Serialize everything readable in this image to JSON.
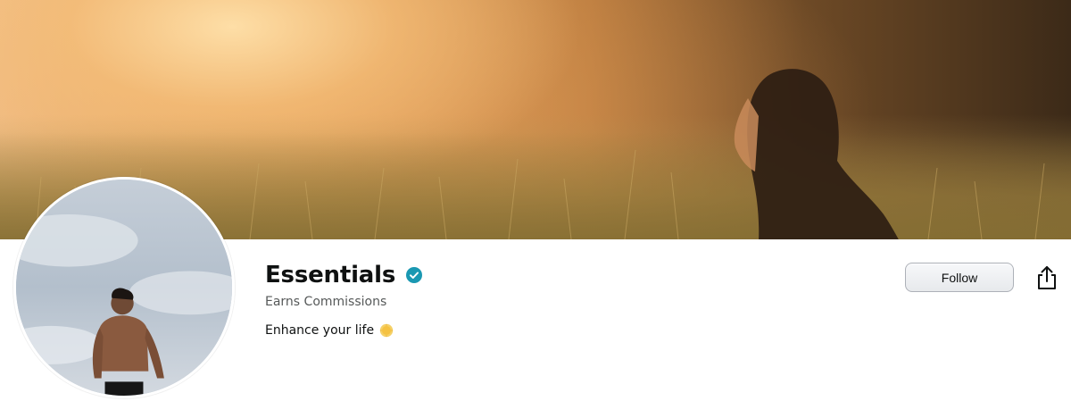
{
  "banner": {
    "image": "cover-photo-woman-in-golden-field"
  },
  "profile": {
    "avatar": "profile-photo-man-against-sky",
    "name": "Essentials",
    "verified_icon": "verified-check-icon",
    "subtitle": "Earns Commissions",
    "bio_text": "Enhance your life",
    "bio_emoji": "sun-emoji-icon"
  },
  "actions": {
    "follow_label": "Follow",
    "share_icon": "share-icon"
  },
  "colors": {
    "verified": "#1a98b2",
    "muted_text": "#565959",
    "primary_text": "#0f1111",
    "sun": "#f5c242"
  }
}
